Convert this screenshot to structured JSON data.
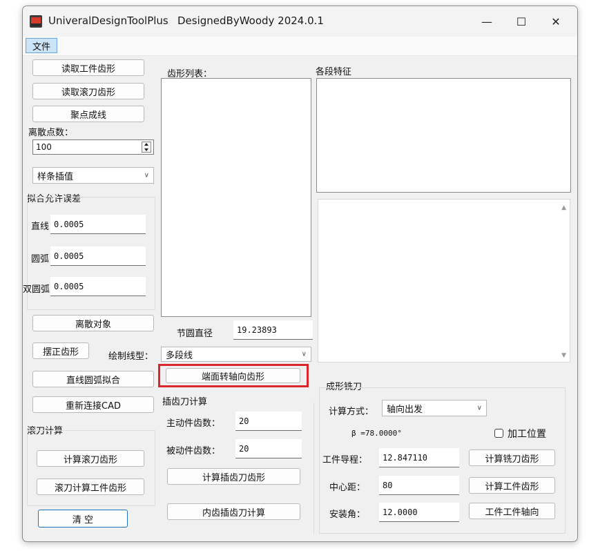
{
  "window": {
    "app_title": "UniveralDesignToolPlus",
    "subtitle": "DesignedByWoody  2024.0.1",
    "minimize": "—",
    "maximize": "☐",
    "close": "✕"
  },
  "menu": {
    "file": "文件"
  },
  "left": {
    "read_workpiece": "读取工件齿形",
    "read_hob": "读取滚刀齿形",
    "cluster_line": "聚点成线",
    "discrete_points_label": "离散点数：",
    "discrete_points_value": "100",
    "interp_method": "样条插值",
    "fit_tolerance_label": "拟合允许误差",
    "line_label": "直线",
    "line_value": "0.0005",
    "arc_label": "圆弧",
    "arc_value": "0.0005",
    "double_arc_label": "双圆弧",
    "double_arc_value": "0.0005",
    "discrete_object": "离散对象",
    "straighten_profile": "摆正齿形",
    "line_arc_fit": "直线圆弧拟合",
    "reconnect_cad": "重新连接CAD",
    "hob_calc_label": "滚刀计算",
    "calc_hob_profile": "计算滚刀齿形",
    "hob_calc_workpiece": "滚刀计算工件齿形",
    "clear": "清 空"
  },
  "middle": {
    "profile_list_label": "齿形列表：",
    "pitch_diameter_label": "节圆直径",
    "pitch_diameter_value": "19.23893",
    "draw_linetype_label": "绘制线型：",
    "draw_linetype_value": "多段线",
    "face_to_axial": "端面转轴向齿形",
    "shaper_calc_label": "插齿刀计算",
    "driver_teeth_label": "主动件齿数：",
    "driver_teeth_value": "20",
    "driven_teeth_label": "被动件齿数：",
    "driven_teeth_value": "20",
    "calc_shaper_profile": "计算插齿刀齿形",
    "internal_shaper_calc": "内齿插齿刀计算"
  },
  "right": {
    "segment_features_label": "各段特征",
    "form_cutter_label": "成形铣刀",
    "calc_mode_label": "计算方式：",
    "calc_mode_value": "轴向出发",
    "beta_text": "β =78.0000°",
    "machining_position": "加工位置",
    "workpiece_lead_label": "工件导程：",
    "workpiece_lead_value": "12.847110",
    "center_distance_label": "中心距：",
    "center_distance_value": "80",
    "install_angle_label": "安装角：",
    "install_angle_value": "12.0000",
    "calc_cutter_profile": "计算铣刀齿形",
    "calc_workpiece_profile": "计算工件齿形",
    "workpiece_axis": "工件工件轴向"
  }
}
